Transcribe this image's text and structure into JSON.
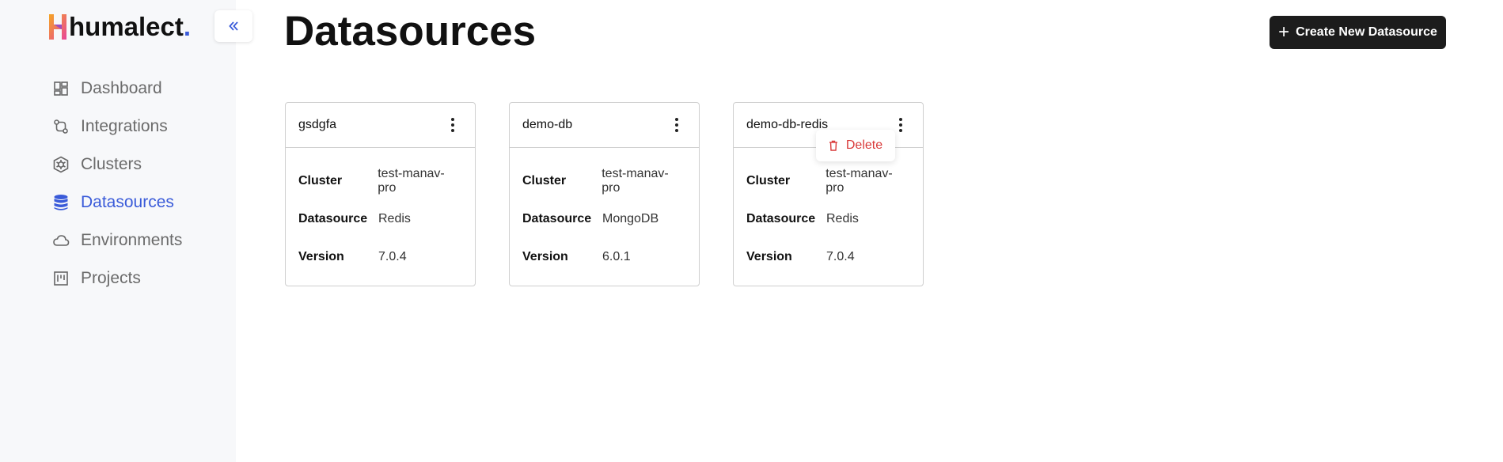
{
  "brand": {
    "name": "humalect",
    "dot": "."
  },
  "sidebar": {
    "items": [
      {
        "label": "Dashboard",
        "icon": "dashboard-icon",
        "active": false
      },
      {
        "label": "Integrations",
        "icon": "integrations-icon",
        "active": false
      },
      {
        "label": "Clusters",
        "icon": "clusters-icon",
        "active": false
      },
      {
        "label": "Datasources",
        "icon": "database-icon",
        "active": true
      },
      {
        "label": "Environments",
        "icon": "cloud-icon",
        "active": false
      },
      {
        "label": "Projects",
        "icon": "projects-icon",
        "active": false
      }
    ]
  },
  "header": {
    "title": "Datasources",
    "create_button": "Create New Datasource"
  },
  "field_labels": {
    "cluster": "Cluster",
    "datasource": "Datasource",
    "version": "Version"
  },
  "cards": [
    {
      "name": "gsdgfa",
      "cluster": "test-manav-pro",
      "datasource": "Redis",
      "version": "7.0.4"
    },
    {
      "name": "demo-db",
      "cluster": "test-manav-pro",
      "datasource": "MongoDB",
      "version": "6.0.1"
    },
    {
      "name": "demo-db-redis",
      "cluster": "test-manav-pro",
      "datasource": "Redis",
      "version": "7.0.4"
    }
  ],
  "menu": {
    "delete_label": "Delete"
  },
  "colors": {
    "accent": "#3a5bd9",
    "danger": "#d93a3a",
    "button_bg": "#1c1c1c",
    "sidebar_bg": "#f7f8fa"
  }
}
